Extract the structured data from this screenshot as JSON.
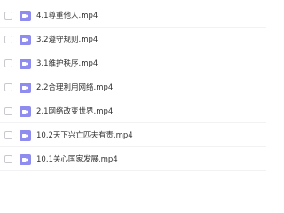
{
  "colors": {
    "icon_bg": "#8f8cf0",
    "icon_fg": "#ffffff",
    "text": "#333333",
    "checkbox_border": "#c8c8d0"
  },
  "icons": {
    "file_type": "video-file-icon",
    "select": "checkbox"
  },
  "files": [
    {
      "name": "4.1尊重他人.mp4",
      "checked": false
    },
    {
      "name": "3.2遵守规则.mp4",
      "checked": false
    },
    {
      "name": "3.1维护秩序.mp4",
      "checked": false
    },
    {
      "name": "2.2合理利用网络.mp4",
      "checked": false
    },
    {
      "name": "2.1网络改变世界.mp4",
      "checked": false
    },
    {
      "name": "10.2天下兴亡匹夫有责.mp4",
      "checked": false
    },
    {
      "name": "10.1关心国家发展.mp4",
      "checked": false
    }
  ]
}
